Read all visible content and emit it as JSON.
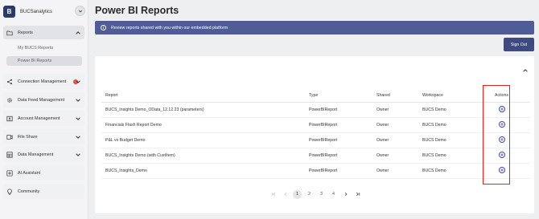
{
  "sidebar": {
    "brand_initial": "B",
    "brand_name": "BUCSanalytics",
    "items": [
      {
        "label": "Reports",
        "icon": "folder-icon"
      },
      {
        "label": "Connection Management",
        "icon": "share-icon",
        "alert": "!"
      },
      {
        "label": "Data Feed Management",
        "icon": "gear-icon"
      },
      {
        "label": "Account Management",
        "icon": "id-card-icon"
      },
      {
        "label": "File Share",
        "icon": "file-share-icon"
      },
      {
        "label": "Data Management",
        "icon": "database-icon"
      },
      {
        "label": "AI Assistant",
        "icon": "ai-icon"
      },
      {
        "label": "Community",
        "icon": "bulb-icon"
      }
    ],
    "sub_items": [
      {
        "label": "My BUCS Reports"
      },
      {
        "label": "Power BI Reports"
      }
    ]
  },
  "header": {
    "title": "Power BI Reports"
  },
  "banner": {
    "text": "Review reports shared with you within our embedded platform"
  },
  "signout_label": "Sign Out",
  "table": {
    "columns": [
      "Report",
      "Type",
      "Shared",
      "Workspace",
      "Actions"
    ],
    "rows": [
      {
        "report": "BUCS_Insights Demo_OData_12.12.23 (parameters)",
        "type": "PowerBIReport",
        "shared": "Owner",
        "workspace": "BUCS Demo"
      },
      {
        "report": "Financials Flash Report Demo",
        "type": "PowerBIReport",
        "shared": "Owner",
        "workspace": "BUCS Demo"
      },
      {
        "report": "P&L vs Budget Demo",
        "type": "PowerBIReport",
        "shared": "Owner",
        "workspace": "BUCS Demo"
      },
      {
        "report": "BUCS_Insights Demo (with CustItem)",
        "type": "PowerBIReport",
        "shared": "Owner",
        "workspace": "BUCS Demo"
      },
      {
        "report": "BUCS_Insights_Demo",
        "type": "PowerBIReport",
        "shared": "Owner",
        "workspace": "BUCS Demo"
      }
    ]
  },
  "pagination": {
    "pages": [
      "1",
      "2",
      "3",
      "4"
    ],
    "current": "1"
  },
  "colors": {
    "banner": "#505c95",
    "signout": "#3f4a80",
    "highlight": "#e0261f",
    "brand": "#2c3a6a"
  }
}
